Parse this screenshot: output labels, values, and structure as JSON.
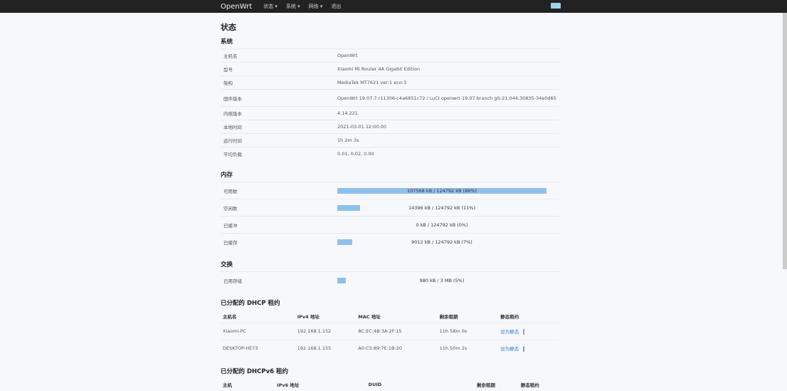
{
  "nav": {
    "brand": "OpenWrt",
    "items": [
      "状态 ▾",
      "系统 ▾",
      "网络 ▾",
      "退出"
    ]
  },
  "page_title": "状态",
  "system": {
    "title": "系统",
    "rows": [
      {
        "k": "主机名",
        "v": "OpenWrt"
      },
      {
        "k": "型号",
        "v": "Xiaomi Mi Router 4A Gigabit Edition"
      },
      {
        "k": "架构",
        "v": "MediaTek MT7621 ver:1 eco:3"
      },
      {
        "k": "固件版本",
        "v": "OpenWrt 19.07.7 r11306-c4a6851c72 / LuCI openwrt-19.07 branch git-21.044.30835-34e0d65"
      },
      {
        "k": "内核版本",
        "v": "4.14.221"
      },
      {
        "k": "本地时间",
        "v": "2021-03-01 12:00:00"
      },
      {
        "k": "运行时间",
        "v": "1h 2m 3s"
      },
      {
        "k": "平均负载",
        "v": "0.01, 0.02, 0.00"
      }
    ]
  },
  "memory": {
    "title": "内存",
    "rows": [
      {
        "k": "可用数",
        "v": "107568 kB / 124792 kB (86%)",
        "pct": 100
      },
      {
        "k": "空闲数",
        "v": "14396 kB / 124792 kB (11%)",
        "pct": 11
      },
      {
        "k": "已缓冲",
        "v": "0 kB / 124792 kB (0%)",
        "pct": 0
      },
      {
        "k": "已缓存",
        "v": "9012 kB / 124792 kB (7%)",
        "pct": 7
      }
    ]
  },
  "swap": {
    "title": "交换",
    "rows": [
      {
        "k": "已用存储",
        "v": "980 kB / 3 MB (5%)",
        "pct": 4
      }
    ]
  },
  "dhcp": {
    "title": "已分配的 DHCP 租约",
    "headers": [
      "主机名",
      "IPv4 地址",
      "MAC 地址",
      "剩余租期",
      "静态租约"
    ],
    "rows": [
      [
        "Xiaomi-PC",
        "192.168.1.152",
        "8C:EC:4B:3A:2F:15",
        "11h 58m 0s",
        "设为静态"
      ],
      [
        "DESKTOP-HE73",
        "192.168.1.155",
        "A0:C5:89:7E:1B:20",
        "11h 50m 2s",
        "设为静态"
      ]
    ]
  },
  "dhcp6": {
    "title": "已分配的 DHCPv6 租约",
    "headers": [
      "主机",
      "IPv6 地址",
      "DUID",
      "剩余租期",
      "静态租约"
    ]
  }
}
